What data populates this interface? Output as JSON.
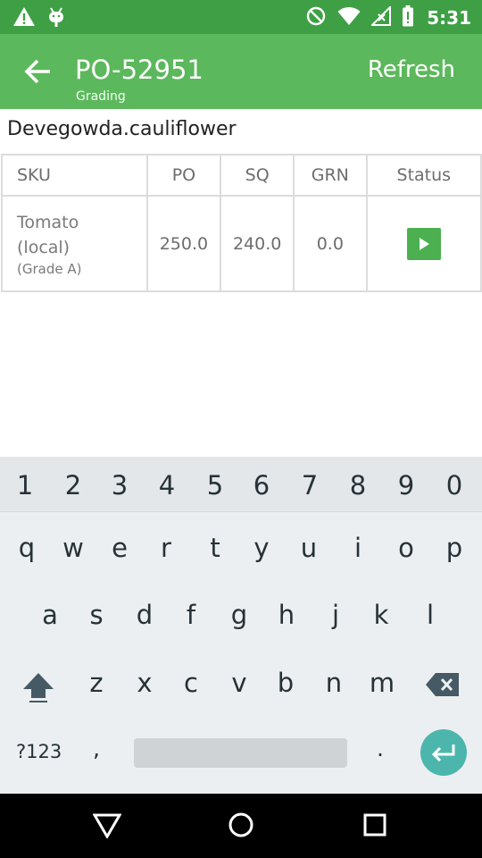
{
  "status_bar": {
    "time": "5:31",
    "left_icons": [
      "warning-icon",
      "android-debug-icon"
    ],
    "right_icons": [
      "do-not-disturb-icon",
      "wifi-icon",
      "no-signal-icon",
      "battery-icon"
    ]
  },
  "app_bar": {
    "title": "PO-52951",
    "subtitle": "Grading",
    "action": "Refresh"
  },
  "farmer_name": "Devegowda.cauliflower",
  "table": {
    "headers": [
      "SKU",
      "PO",
      "SQ",
      "GRN",
      "Status"
    ],
    "rows": [
      {
        "sku_name": "Tomato (local)",
        "sku_grade": "(Grade A)",
        "po": "250.0",
        "sq": "240.0",
        "grn": "0.0",
        "status_icon": "play-icon"
      }
    ]
  },
  "keyboard": {
    "number_row": [
      "1",
      "2",
      "3",
      "4",
      "5",
      "6",
      "7",
      "8",
      "9",
      "0"
    ],
    "row1": [
      "q",
      "w",
      "e",
      "r",
      "t",
      "y",
      "u",
      "i",
      "o",
      "p"
    ],
    "row2": [
      "a",
      "s",
      "d",
      "f",
      "g",
      "h",
      "j",
      "k",
      "l"
    ],
    "row3": [
      "z",
      "x",
      "c",
      "v",
      "b",
      "n",
      "m"
    ],
    "symbols_key": "?123",
    "comma_key": ",",
    "period_key": "."
  },
  "colors": {
    "status_bar": "#3f9f45",
    "app_bar": "#5cb85c",
    "play_button": "#4caf50",
    "enter_key": "#4db6ac"
  }
}
